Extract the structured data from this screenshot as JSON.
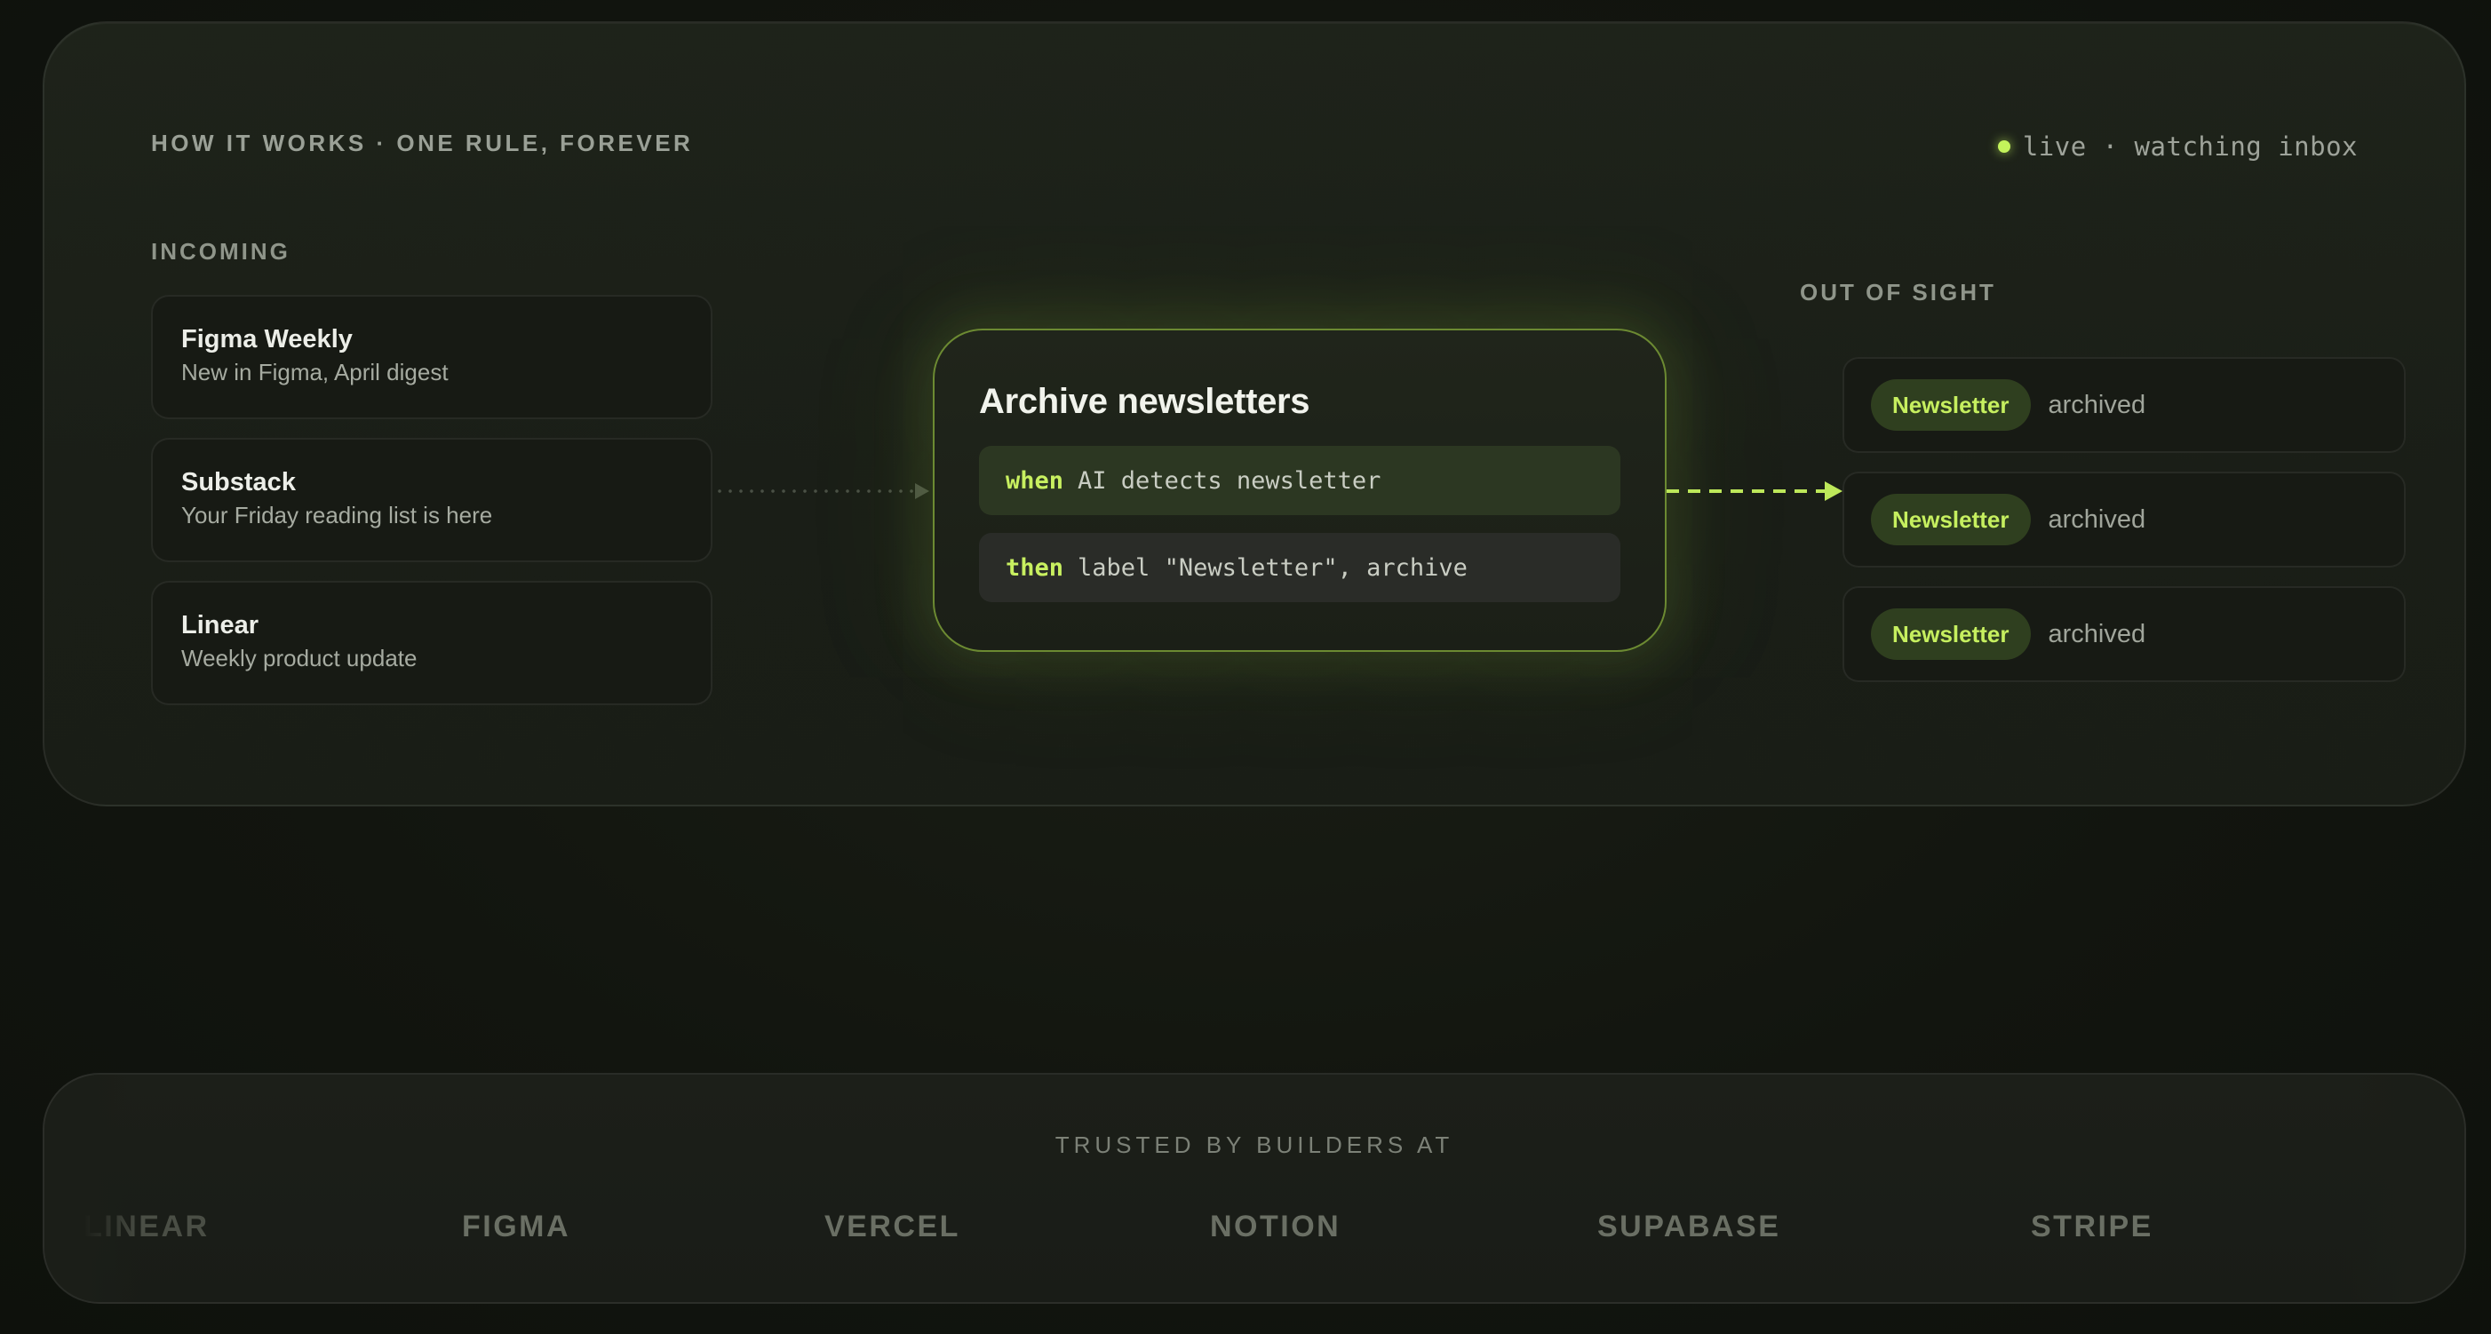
{
  "how_it_works": {
    "title": "HOW IT WORKS · ONE RULE, FOREVER",
    "live_status": "live · watching inbox"
  },
  "incoming": {
    "label": "INCOMING",
    "emails": [
      {
        "sender": "Figma Weekly",
        "subject": "New in Figma, April digest"
      },
      {
        "sender": "Substack",
        "subject": "Your Friday reading list is here"
      },
      {
        "sender": "Linear",
        "subject": "Weekly product update"
      }
    ]
  },
  "rule": {
    "title": "Archive newsletters",
    "when_keyword": "when",
    "when_text": "AI detects newsletter",
    "then_keyword": "then",
    "then_text": "label \"Newsletter\", archive"
  },
  "out_of_sight": {
    "label": "OUT OF SIGHT",
    "items": [
      {
        "tag": "Newsletter",
        "status": "archived"
      },
      {
        "tag": "Newsletter",
        "status": "archived"
      },
      {
        "tag": "Newsletter",
        "status": "archived"
      }
    ]
  },
  "trusted": {
    "title": "TRUSTED BY BUILDERS AT",
    "logos": [
      "LINEAR",
      "FIGMA",
      "VERCEL",
      "NOTION",
      "SUPABASE",
      "STRIPE"
    ]
  },
  "colors": {
    "accent": "#c3f35b",
    "background": "#12150f",
    "panel": "#1c2019"
  }
}
